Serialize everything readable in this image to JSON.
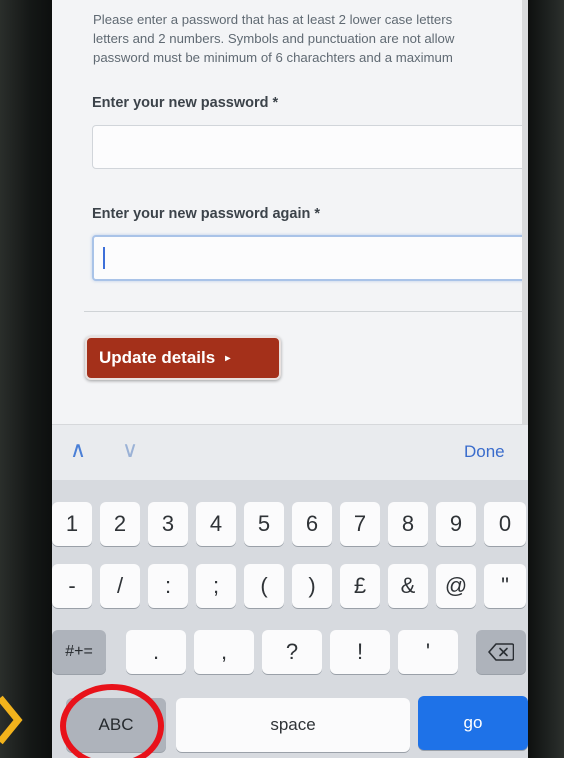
{
  "page": {
    "instructions": [
      "Please enter a password that has at least 2 lower case letters",
      "letters and 2 numbers. Symbols and punctuation are not allow",
      "password must be minimum of 6 charachters and a maximum"
    ],
    "label_new_password": "Enter your new password *",
    "label_new_password_again": "Enter your new password again *",
    "new_password_value": "",
    "new_password_again_value": "",
    "update_button": "Update details",
    "update_arrow": "▸"
  },
  "toolbar": {
    "prev_icon": "chevron-up-icon",
    "next_icon": "chevron-down-icon",
    "prev_glyph": "∧",
    "next_glyph": "∨",
    "done": "Done"
  },
  "keyboard": {
    "row1": [
      "1",
      "2",
      "3",
      "4",
      "5",
      "6",
      "7",
      "8",
      "9",
      "0"
    ],
    "row2": [
      "-",
      "/",
      ":",
      ";",
      "(",
      ")",
      "£",
      "&",
      "@",
      "\""
    ],
    "row3": [
      "#+=",
      ".",
      ",",
      "?",
      "!",
      "'"
    ],
    "backspace_icon": "backspace-icon",
    "abc": "ABC",
    "space": "space",
    "go": "go"
  },
  "annotations": {
    "arrow_color": "#f2b31c",
    "circle_color": "#e8121a"
  }
}
